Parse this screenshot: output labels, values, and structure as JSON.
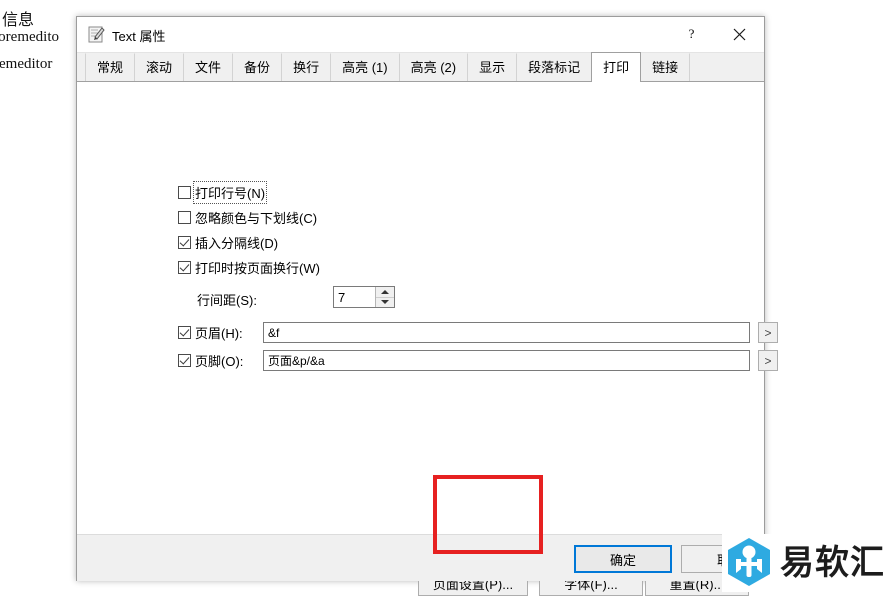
{
  "background": {
    "lines": [
      "信息",
      "toremedito",
      "remeditor"
    ]
  },
  "dialog": {
    "title": "Text 属性",
    "icon": "notepad-pencil-icon",
    "titlebar_buttons": [
      {
        "name": "help-button",
        "glyph": "?"
      },
      {
        "name": "close-button",
        "glyph": "✕"
      }
    ],
    "tabs": [
      {
        "label": "常规",
        "active": false
      },
      {
        "label": "滚动",
        "active": false
      },
      {
        "label": "文件",
        "active": false
      },
      {
        "label": "备份",
        "active": false
      },
      {
        "label": "换行",
        "active": false
      },
      {
        "label": "高亮 (1)",
        "active": false
      },
      {
        "label": "高亮 (2)",
        "active": false
      },
      {
        "label": "显示",
        "active": false
      },
      {
        "label": "段落标记",
        "active": false
      },
      {
        "label": "打印",
        "active": true
      },
      {
        "label": "链接",
        "active": false
      }
    ],
    "checkboxes": [
      {
        "label": "打印行号(N)",
        "accel": "N",
        "checked": false,
        "focused": true
      },
      {
        "label": "忽略颜色与下划线(C)",
        "accel": "C",
        "checked": false,
        "focused": false
      },
      {
        "label": "插入分隔线(D)",
        "accel": "D",
        "checked": true,
        "focused": false
      },
      {
        "label": "打印时按页面换行(W)",
        "accel": "W",
        "checked": true,
        "focused": false
      }
    ],
    "line_spacing": {
      "label": "行间距(S):",
      "value": "7",
      "spinner_up": "▲",
      "spinner_down": "▼"
    },
    "header": {
      "label": "页眉(H):",
      "checked": true,
      "value": "&f",
      "arrow_label": ">"
    },
    "footer": {
      "label": "页脚(O):",
      "checked": true,
      "value": "页面&p/&a",
      "arrow_label": ">"
    },
    "page_buttons": [
      {
        "label": "页面设置(P)..."
      },
      {
        "label": "字体(F)..."
      },
      {
        "label": "重置(R)..."
      }
    ],
    "footer_buttons": [
      {
        "label": "确定",
        "default": true
      },
      {
        "label": "取消",
        "default": false
      }
    ]
  },
  "annotation": {
    "shape": "rectangle",
    "color": "#e62121",
    "target": "页面设置(P)..."
  },
  "watermark": {
    "text": "易软汇",
    "logo_color": "#2eaae1"
  },
  "colors": {
    "accent": "#0078d7",
    "dialog_bg": "#f0f0f0",
    "page_bg": "#ffffff",
    "annotation_red": "#e62121"
  }
}
